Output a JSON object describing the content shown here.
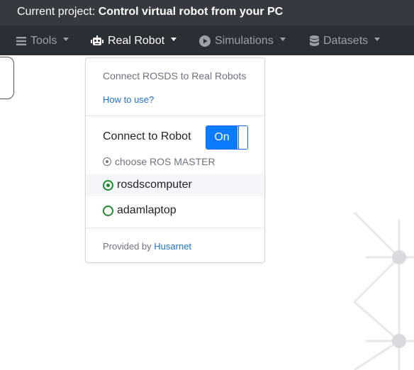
{
  "header": {
    "project_label": "Current project:",
    "project_name": "Control virtual robot from your PC"
  },
  "nav": {
    "tools": "Tools",
    "real_robot": "Real Robot",
    "simulations": "Simulations",
    "datasets": "Datasets"
  },
  "dropdown": {
    "title": "Connect ROSDS to Real Robots",
    "how_to_link": "How to use?",
    "connect_label": "Connect to Robot",
    "toggle_label": "On",
    "choose_master": "choose ROS MASTER",
    "options": [
      {
        "label": "rosdscomputer",
        "selected": true
      },
      {
        "label": "adamlaptop",
        "selected": false
      }
    ],
    "footer_prefix": "Provided by",
    "footer_link": "Husarnet"
  }
}
